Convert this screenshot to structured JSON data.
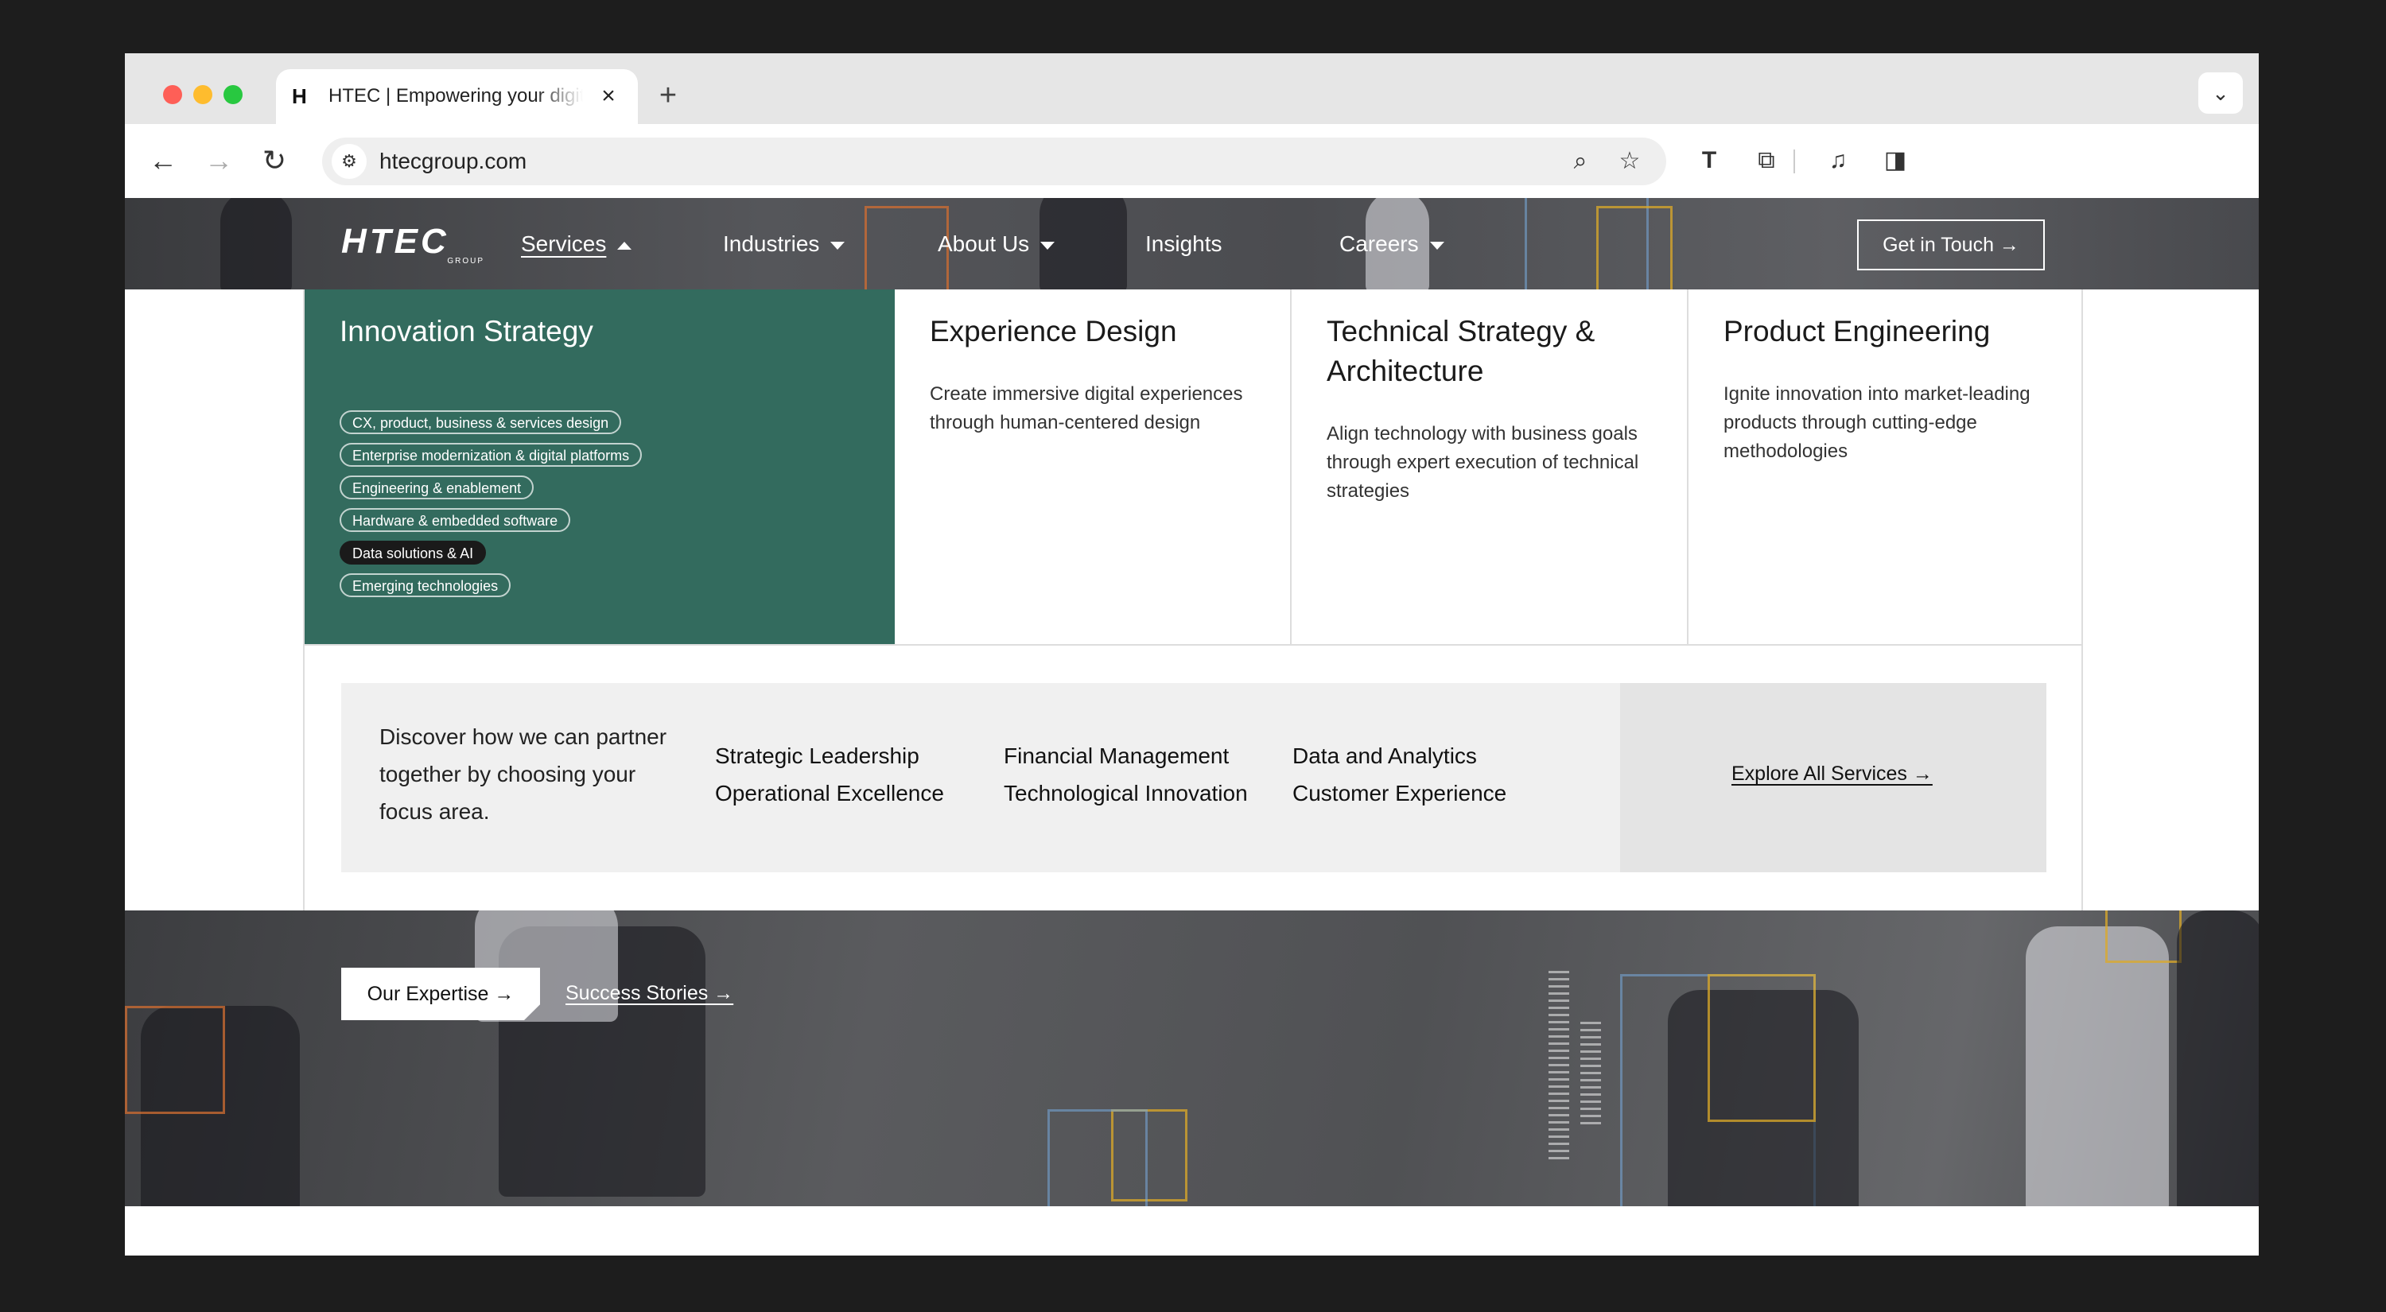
{
  "browser": {
    "tab_title": "HTEC | Empowering your digital",
    "tab_favicon": "H",
    "url": "htecgroup.com",
    "icons": [
      "back-arrow-icon",
      "forward-arrow-icon",
      "reload-icon",
      "site-info-icon",
      "zoom-icon",
      "star-icon",
      "translate-icon",
      "extensions-icon",
      "media-controls-icon",
      "side-panel-icon",
      "tab-search-chevron-icon"
    ]
  },
  "site": {
    "logo": "HTEC",
    "logo_sub": "GROUP",
    "nav": {
      "services": "Services",
      "industries": "Industries",
      "about": "About Us",
      "insights": "Insights",
      "careers": "Careers",
      "cta": "Get in Touch →"
    }
  },
  "menu": {
    "cards": [
      {
        "title": "Innovation Strategy",
        "chips": [
          "CX, product, business & services design",
          "Enterprise modernization & digital platforms",
          "Engineering & enablement",
          "Hardware & embedded software",
          "Data solutions & AI",
          "Emerging technologies"
        ],
        "selected_chip": "Data solutions & AI"
      },
      {
        "title": "Experience Design",
        "desc": "Create immersive digital experiences through human-centered design"
      },
      {
        "title": "Technical Strategy & Architecture",
        "desc": "Align technology with business goals through expert execution of technical strategies"
      },
      {
        "title": "Product Engineering",
        "desc": "Ignite innovation into market-leading products through cutting-edge methodologies"
      }
    ],
    "focus": {
      "intro": "Discover how we can partner together by choosing your focus area.",
      "links": [
        "Strategic Leadership",
        "Operational Excellence",
        "Financial Management",
        "Technological Innovation",
        "Data and Analytics",
        "Customer Experience"
      ],
      "explore": "Explore All Services →"
    }
  },
  "hero": {
    "expertise": "Our Expertise →",
    "stories": "Success Stories →"
  },
  "colors": {
    "accent_green": "#336b5e",
    "chip_selected": "#1a1a1a"
  }
}
